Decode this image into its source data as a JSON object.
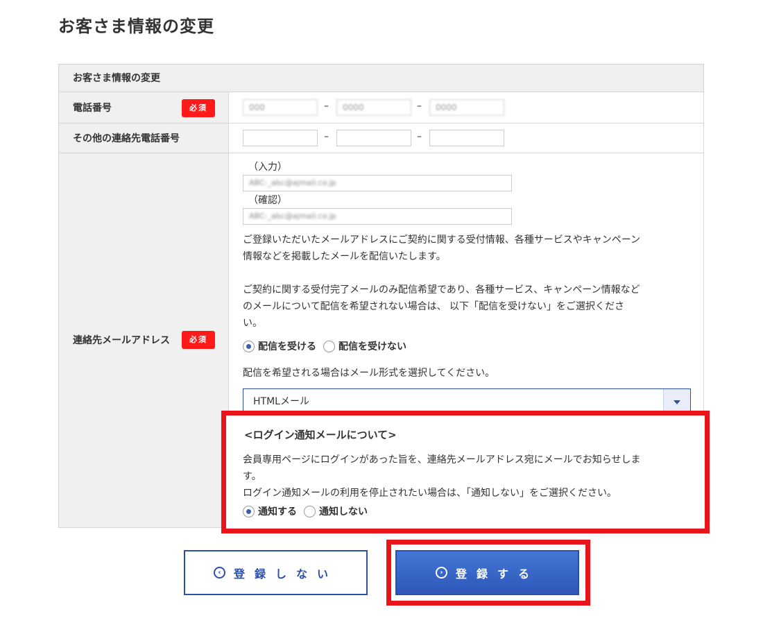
{
  "page_title": "お客さま情報の変更",
  "form": {
    "header": "お客さま情報の変更",
    "required_badge": "必須",
    "phone": {
      "label": "電話番号",
      "values": [
        "000",
        "0000",
        "0000"
      ],
      "separator": "–"
    },
    "other_phone": {
      "label": "その他の連絡先電話番号",
      "values": [
        "",
        "",
        ""
      ],
      "separator": "–"
    },
    "email": {
      "label": "連絡先メールアドレス",
      "input_label": "（入力）",
      "confirm_label": "（確認）",
      "input_value": "ABC-_abc@ajmail.co.jp",
      "confirm_value": "ABC-_abc@ajmail.co.jp",
      "desc1_line1": "ご登録いただいたメールアドレスにご契約に関する受付情報、各種サービスやキャンペーン",
      "desc1_line2": "情報などを掲載したメールを配信いたします。",
      "desc2_line1": "ご契約に関する受付完了メールのみ配信希望であり、各種サービス、キャンペーン情報など",
      "desc2_line2": "のメールについて配信を希望されない場合は、 以下「配信を受けない」をご選択くださ",
      "desc2_line3": "い。",
      "delivery_options": [
        "配信を受ける",
        "配信を受けない"
      ],
      "delivery_selected": "配信を受ける",
      "format_prompt": "配信を希望される場合はメール形式を選択してください。",
      "format_selected": "HTMLメール"
    },
    "login_notice": {
      "title": "<ログイン通知メールについて>",
      "line1": "会員専用ページにログインがあった旨を、連絡先メールアドレス宛にメールでお知らせしま",
      "line2": "す。",
      "line3": "ログイン通知メールの利用を停止されたい場合は、「通知しない」をご選択ください。",
      "options": [
        "通知する",
        "通知しない"
      ],
      "selected": "通知する"
    }
  },
  "buttons": {
    "cancel": "登録しない",
    "submit": "登録する",
    "cancel_icon": "chevron-left-circle-icon",
    "submit_icon": "chevron-right-circle-icon"
  },
  "colors": {
    "accent": "#2b4fa8",
    "required": "#ff1a1a",
    "highlight": "#e8141a"
  }
}
